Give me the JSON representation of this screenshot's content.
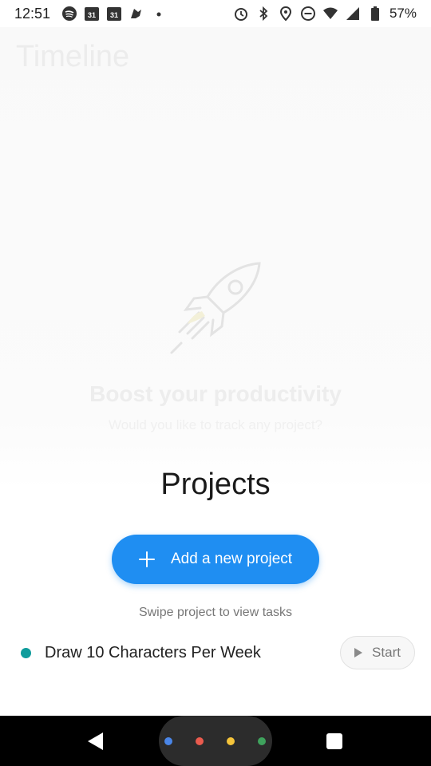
{
  "status_bar": {
    "time": "12:51",
    "battery": "57%",
    "left_icons": [
      "spotify-icon",
      "calendar-icon",
      "calendar-icon",
      "app-icon",
      "dot-icon"
    ],
    "right_icons": [
      "alarm-icon",
      "bluetooth-icon",
      "location-icon",
      "dnd-icon",
      "wifi-icon",
      "signal-icon",
      "battery-icon"
    ],
    "calendar_day": "31"
  },
  "background": {
    "title": "Timeline",
    "headline": "Boost your productivity",
    "subtitle": "Would you like to track any project?",
    "illustration": "rocket-icon"
  },
  "sheet": {
    "title": "Projects",
    "add_button_label": "Add a new project",
    "hint": "Swipe project to view tasks",
    "projects": [
      {
        "name": "Draw 10 Characters Per Week",
        "color": "#0f9c9c",
        "action_label": "Start"
      }
    ]
  },
  "colors": {
    "accent": "#1f8ef2",
    "project_teal": "#0f9c9c"
  },
  "nav_bar": {
    "dots": [
      "#4a86e8",
      "#ea5b4e",
      "#f5c43a",
      "#3fa35d"
    ]
  }
}
